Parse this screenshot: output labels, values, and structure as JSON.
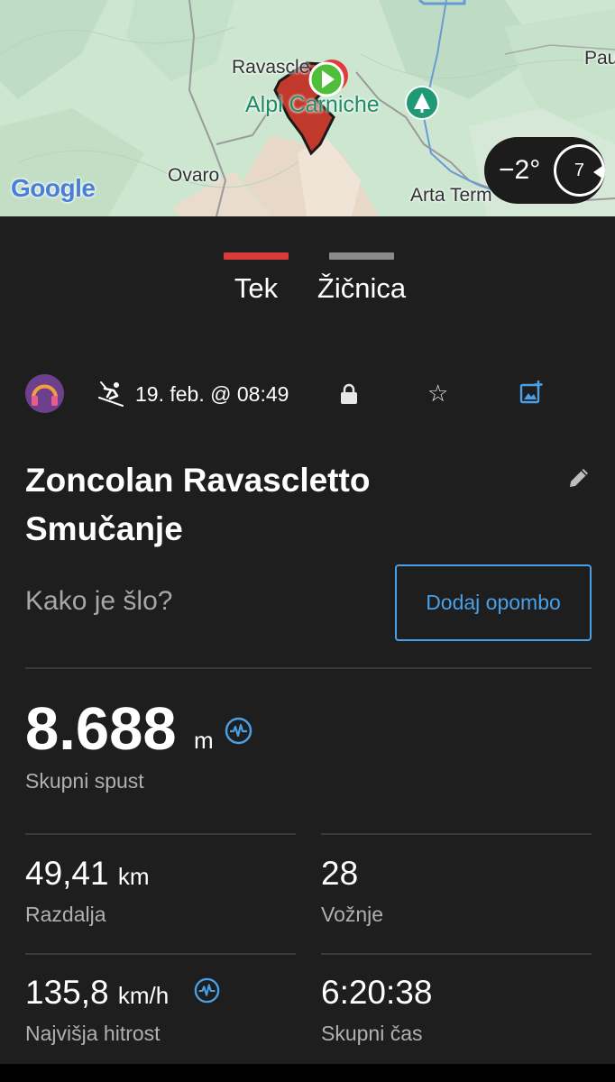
{
  "map": {
    "labels": {
      "ravascletto": "Ravascle",
      "alpi_carniche": "Alpi Carniche",
      "ovaro": "Ovaro",
      "arta_terme": "Arta Term",
      "paularo": "Pau"
    },
    "attribution": "Google",
    "weather": {
      "temperature": "−2°",
      "wind": "7"
    }
  },
  "tabs": [
    {
      "label": "Tek",
      "active": true,
      "color": "#d93a3a"
    },
    {
      "label": "Žičnica",
      "active": false,
      "color": "#8a8a8a"
    }
  ],
  "activity": {
    "date": "19. feb. @ 08:49",
    "title_line1": "Zoncolan Ravascletto",
    "title_line2": "Smučanje",
    "note_placeholder": "Kako je šlo?",
    "add_note_label": "Dodaj opombo",
    "icons": [
      "avatar-headphones",
      "skiing-icon",
      "lock-icon",
      "star-icon",
      "add-photo-icon",
      "edit-icon"
    ]
  },
  "stats": {
    "descent": {
      "value": "8.688",
      "unit": "m",
      "label": "Skupni spust"
    },
    "distance": {
      "value": "49,41",
      "unit": "km",
      "label": "Razdalja"
    },
    "runs": {
      "value": "28",
      "label": "Vožnje"
    },
    "max_speed": {
      "value": "135,8",
      "unit": "km/h",
      "label": "Najvišja hitrost"
    },
    "total_time": {
      "value": "6:20:38",
      "label": "Skupni čas"
    }
  },
  "colors": {
    "background": "#1e1e1f",
    "accent_blue": "#4aa0e6",
    "accent_red": "#d93a3a"
  }
}
